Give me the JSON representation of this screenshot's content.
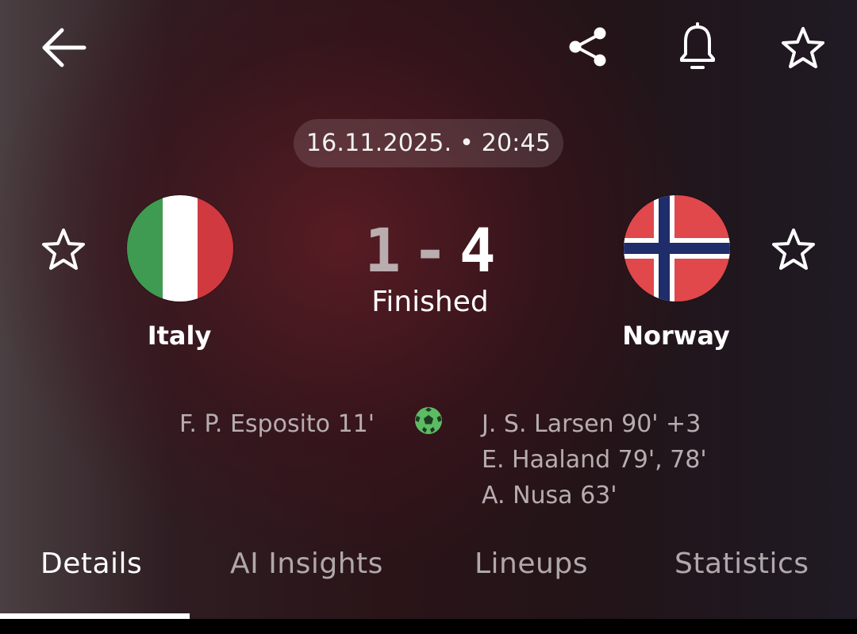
{
  "header": {
    "back_icon": "arrow-left-icon",
    "share_icon": "share-icon",
    "notification_icon": "bell-icon",
    "favorite_icon": "star-outline-icon"
  },
  "match": {
    "datetime": "16.11.2025. • 20:45",
    "home_team": {
      "name": "Italy",
      "score": "1",
      "flag_colors": [
        "#3f9a52",
        "#ffffff",
        "#d0393f"
      ]
    },
    "away_team": {
      "name": "Norway",
      "score": "4",
      "flag_colors": [
        "#e0484b",
        "#ffffff",
        "#1f2d6b"
      ]
    },
    "score_separator": "-",
    "status": "Finished",
    "goal_icon": "soccer-ball-icon",
    "home_scorers": [
      "F. P. Esposito 11'"
    ],
    "away_scorers": [
      "J. S. Larsen 90' +3",
      "E. Haaland 79', 78'",
      "A. Nusa 63'"
    ]
  },
  "tabs": [
    {
      "label": "Details",
      "active": true
    },
    {
      "label": "AI Insights",
      "active": false
    },
    {
      "label": "Lineups",
      "active": false
    },
    {
      "label": "Statistics",
      "active": false
    }
  ],
  "colors": {
    "active_tab": "#ffffff",
    "inactive_tab": "#b0a8ab",
    "goal_icon": "#5dbb63"
  }
}
